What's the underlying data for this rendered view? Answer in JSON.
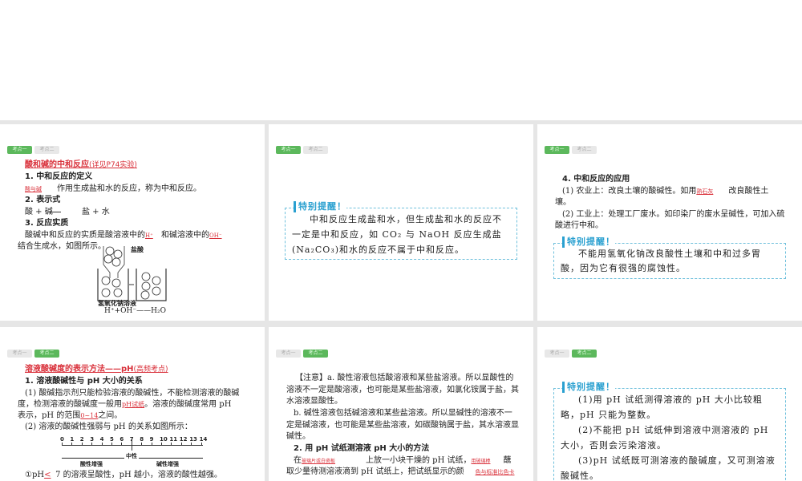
{
  "tabs": {
    "one": "考点一",
    "two": "考点二"
  },
  "s1": {
    "title": "酸和碱的中和反应",
    "ref": "(详见P74实验)",
    "h1": "1. 中和反应的定义",
    "def_ans": "酸与碱",
    "def": "作用生成盐和水的反应，称为中和反应。",
    "h2": "2. 表示式",
    "formula_l": "酸 + 碱",
    "formula_r": "盐 + 水",
    "h3": "3. 反应实质",
    "p1": "酸碱中和反应的实质是酸溶液中的",
    "a1": "H⁺",
    "p2": "和碱溶液中的",
    "a2": "OH⁻",
    "p3": "结合生成水，如图所示。",
    "lbl_acid": "盐酸",
    "lbl_base": "氢氧化钠溶液",
    "eq": "H⁺+OH⁻——H₂O"
  },
  "s2": {
    "tip_head": "特别提醒！",
    "tip": "中和反应生成盐和水，但生成盐和水的反应不一定是中和反应，如 CO₂ 与 NaOH 反应生成盐(Na₂CO₃)和水的反应不属于中和反应。"
  },
  "s3": {
    "h4": "4. 中和反应的应用",
    "l1a": "(1) 农业上：改良土壤的酸碱性。如用",
    "l1ans": "熟石灰",
    "l1b": "改良酸性土",
    "l1c": "壤。",
    "l2": "(2) 工业上：处理工厂废水。如印染厂的废水呈碱性，可加入硫",
    "l2b": "酸进行中和。",
    "tip_head": "特别提醒！",
    "tip": "不能用氢氧化钠改良酸性土壤和中和过多胃酸，因为它有很强的腐蚀性。"
  },
  "s4": {
    "title": "溶液酸碱度的表示方法——pH",
    "ref": "(高频考点)",
    "h1": "1. 溶液酸碱性与 pH 大小的关系",
    "p1": "(1) 酸碱指示剂只能检验溶液的酸碱性，不能检测溶液的酸碱",
    "p2a": "度，检测溶液的酸碱度一般用",
    "p2ans": "pH试纸",
    "p2b": "。溶液的酸碱度常用 pH",
    "p3a": "表示，pH 的范围",
    "p3ans": "0~14",
    "p3b": "之间。",
    "p4": "(2) 溶液的酸碱性强弱与 pH 的关系如图所示：",
    "scale": [
      "0",
      "1",
      "2",
      "3",
      "4",
      "5",
      "6",
      "7",
      "8",
      "9",
      "10",
      "11",
      "12",
      "13",
      "14"
    ],
    "neutral": "中性",
    "acid": "酸性增强",
    "base": "碱性增强",
    "p5a": "①pH",
    "p5ans": "<",
    "p5b": "7 的溶液呈酸性，pH 越小，溶液的酸性越强。"
  },
  "s5": {
    "n1": "【注意】a. 酸性溶液包括酸溶液和某些盐溶液。所以显酸性的",
    "n2": "溶液不一定是酸溶液，也可能是某些盐溶液，如氯化铵属于盐，其",
    "n3": "水溶液显酸性。",
    "n4": "b. 碱性溶液包括碱溶液和某些盐溶液。所以显碱性的溶液不一",
    "n5": "定是碱溶液，也可能是某些盐溶液，如碳酸钠属于盐，其水溶液显",
    "n6": "碱性。",
    "h2": "2. 用 pH 试纸测溶液 pH 大小的方法",
    "m1a": "在",
    "m1ans": "玻璃片或白瓷板",
    "m1b": "上放一小块干燥的 pH 试纸，",
    "m1ans2": "用玻璃棒",
    "m1c": "蘸",
    "m2a": "取少量待测溶液滴到 pH 试纸上，把试纸显示的颜",
    "m2ans": "色与标准比色卡"
  },
  "s6": {
    "tip_head": "特别提醒！",
    "t1": "(1)用 pH 试纸测得溶液的 pH 大小比较粗略，pH 只能为整数。",
    "t2": "(2)不能把 pH 试纸伸到溶液中测溶液的 pH 大小，否则会污染溶液。",
    "t3": "(3)pH 试纸既可测溶液的酸碱度，又可测溶液酸碱性。"
  }
}
